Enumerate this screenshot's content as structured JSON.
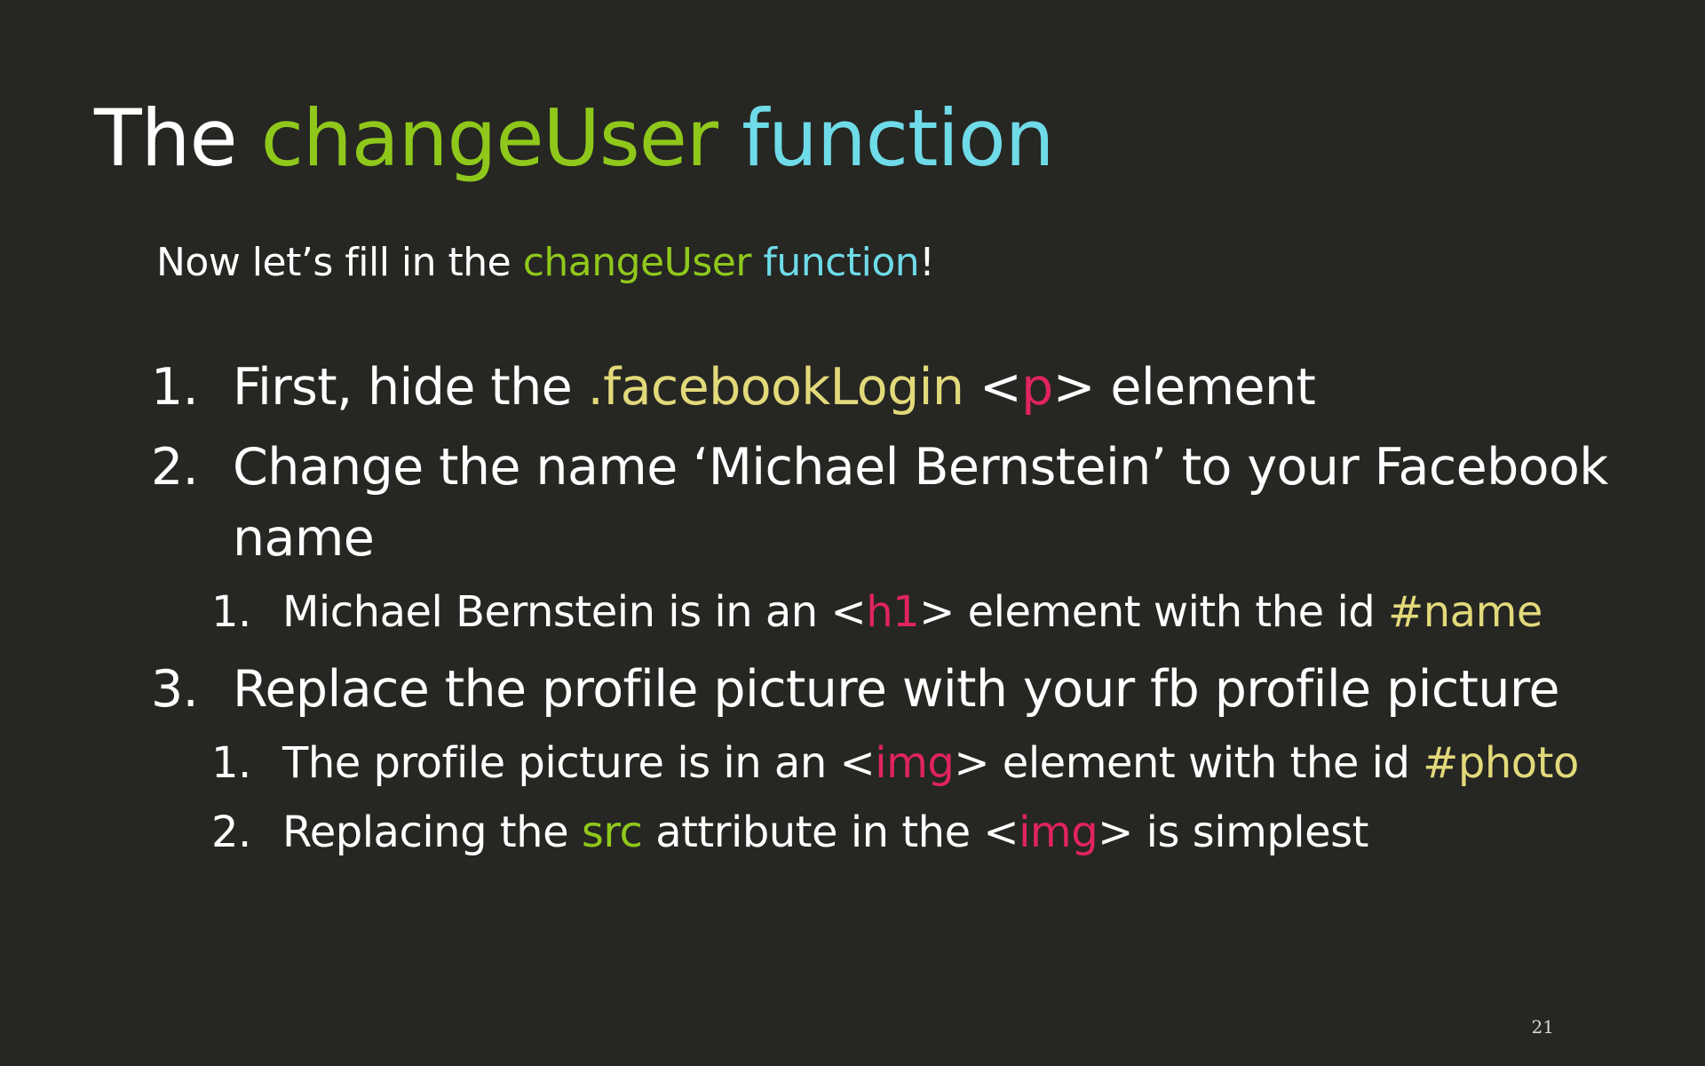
{
  "slide": {
    "title": {
      "part1": "The ",
      "part2": "changeUser",
      "part3": " ",
      "part4": "function"
    },
    "subtitle": {
      "part1": "Now let’s fill in the ",
      "part2": "changeUser",
      "part3": " ",
      "part4": "function",
      "part5": "!"
    },
    "items": [
      {
        "num": "1.",
        "t1": "First, hide the ",
        "t2": ".facebookLogin",
        "t3": " <",
        "t4": "p",
        "t5": "> element"
      },
      {
        "num": "2.",
        "line1": "Change the name ‘Michael Bernstein’ to your Facebook",
        "line2": "name",
        "sub": [
          {
            "num": "1.",
            "t1": "Michael Bernstein is in an <",
            "t2": "h1",
            "t3": "> element with the id ",
            "t4": "#name"
          }
        ]
      },
      {
        "num": "3.",
        "line1": "Replace the profile picture with your fb profile picture",
        "sub": [
          {
            "num": "1.",
            "t1": "The profile picture is in an <",
            "t2": "img",
            "t3": "> element with the id ",
            "t4": "#photo"
          },
          {
            "num": "2.",
            "t1": "Replacing the ",
            "t2": "src",
            "t3": " attribute in the <",
            "t4": "img",
            "t5": "> is simplest"
          }
        ]
      }
    ],
    "page_number": "21"
  },
  "colors": {
    "background": "#262623",
    "text": "#ffffff",
    "green": "#8fc81b",
    "cyan": "#6fdbe8",
    "yellow": "#e2d97a",
    "pink": "#e0245d"
  }
}
